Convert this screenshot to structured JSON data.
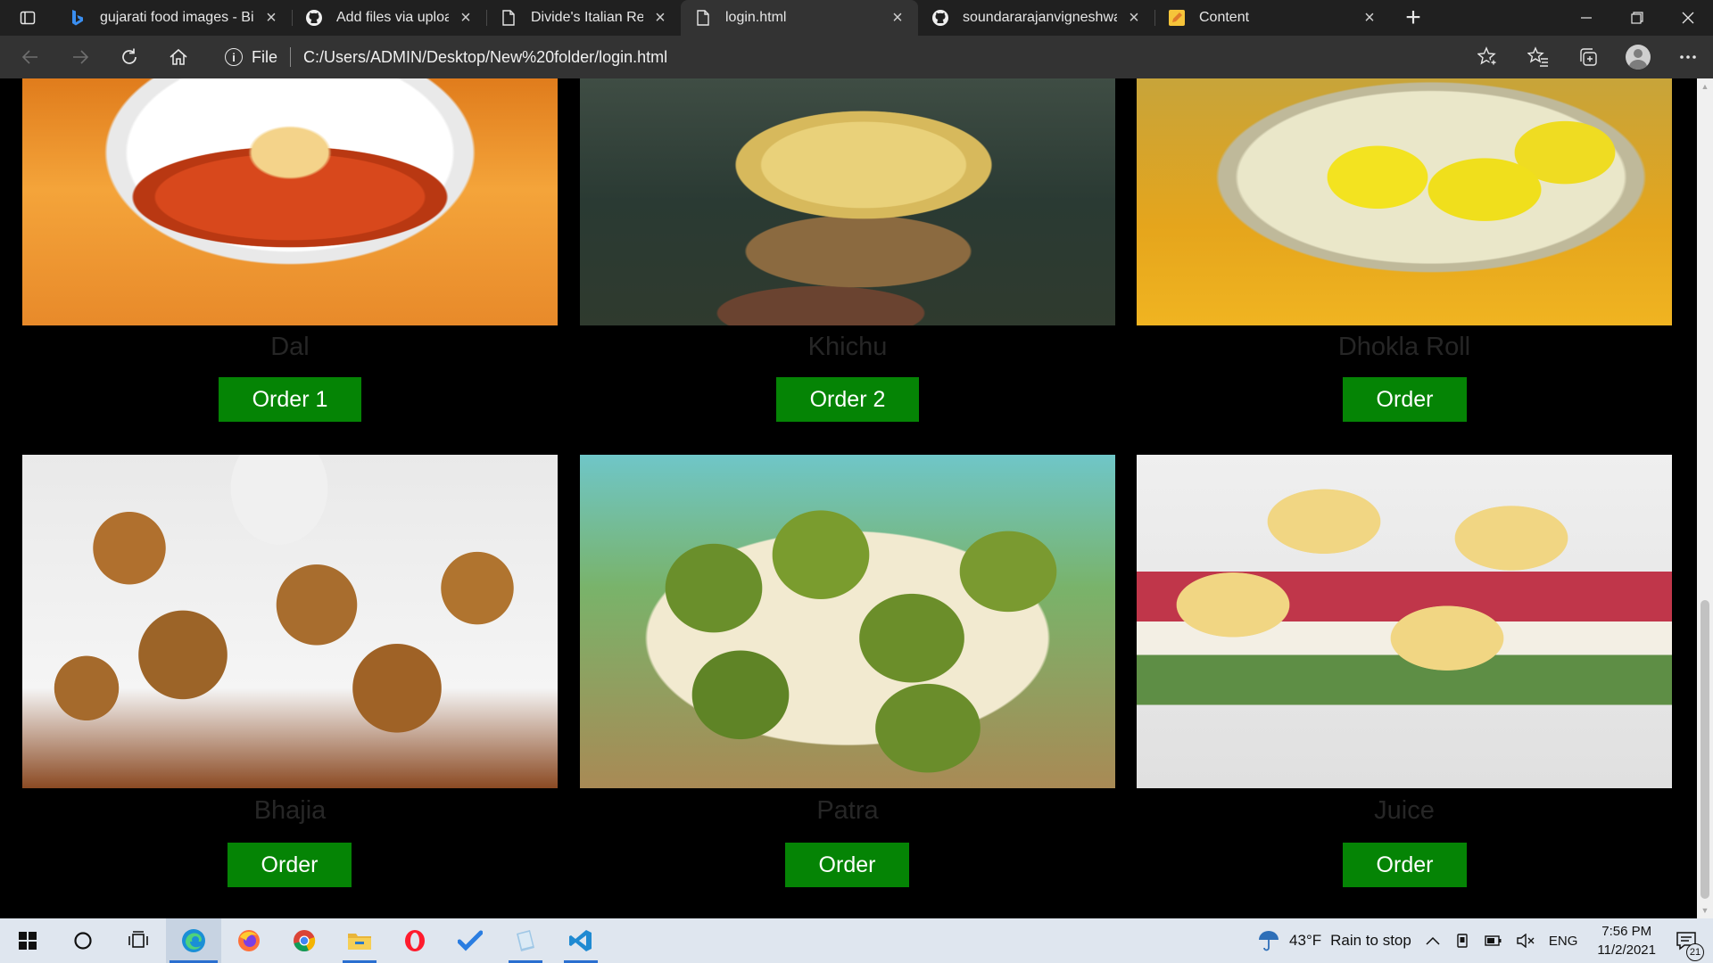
{
  "browser": {
    "tabs": [
      {
        "title": "gujarati food images - Bing",
        "icon": "bing-icon",
        "active": false
      },
      {
        "title": "Add files via upload · sound",
        "icon": "github-icon",
        "active": false
      },
      {
        "title": "Divide's Italian Restaurant",
        "icon": "file-icon",
        "active": false
      },
      {
        "title": "login.html",
        "icon": "file-icon",
        "active": true
      },
      {
        "title": "soundararajanvigneshwaran",
        "icon": "github-icon",
        "active": false
      },
      {
        "title": "Content",
        "icon": "pencil-note-icon",
        "active": false
      }
    ],
    "address": {
      "scheme_label": "File",
      "url": "C:/Users/ADMIN/Desktop/New%20folder/login.html"
    }
  },
  "menu": {
    "items": [
      {
        "name": "Dal",
        "button": "Order 1",
        "image": "dal-photo"
      },
      {
        "name": "Khichu",
        "button": "Order 2",
        "image": "khichu-photo"
      },
      {
        "name": "Dhokla Roll",
        "button": "Order",
        "image": "dhokla-roll-photo"
      },
      {
        "name": "Bhajia",
        "button": "Order",
        "image": "bhajia-photo"
      },
      {
        "name": "Patra",
        "button": "Order",
        "image": "patra-photo"
      },
      {
        "name": "Juice",
        "button": "Order",
        "image": "juice-photo"
      }
    ],
    "button_color": "#058405",
    "name_color": "#262626"
  },
  "taskbar": {
    "apps": [
      "windows-start-icon",
      "search-circle-icon",
      "task-view-icon",
      "edge-icon",
      "firefox-icon",
      "chrome-icon",
      "file-explorer-icon",
      "opera-icon",
      "todo-check-icon",
      "notepad-icon",
      "vscode-icon"
    ],
    "weather": {
      "temp": "43°F",
      "condition": "Rain to stop"
    },
    "language": "ENG",
    "time": "7:56 PM",
    "date": "11/2/2021",
    "notifications": "21"
  }
}
